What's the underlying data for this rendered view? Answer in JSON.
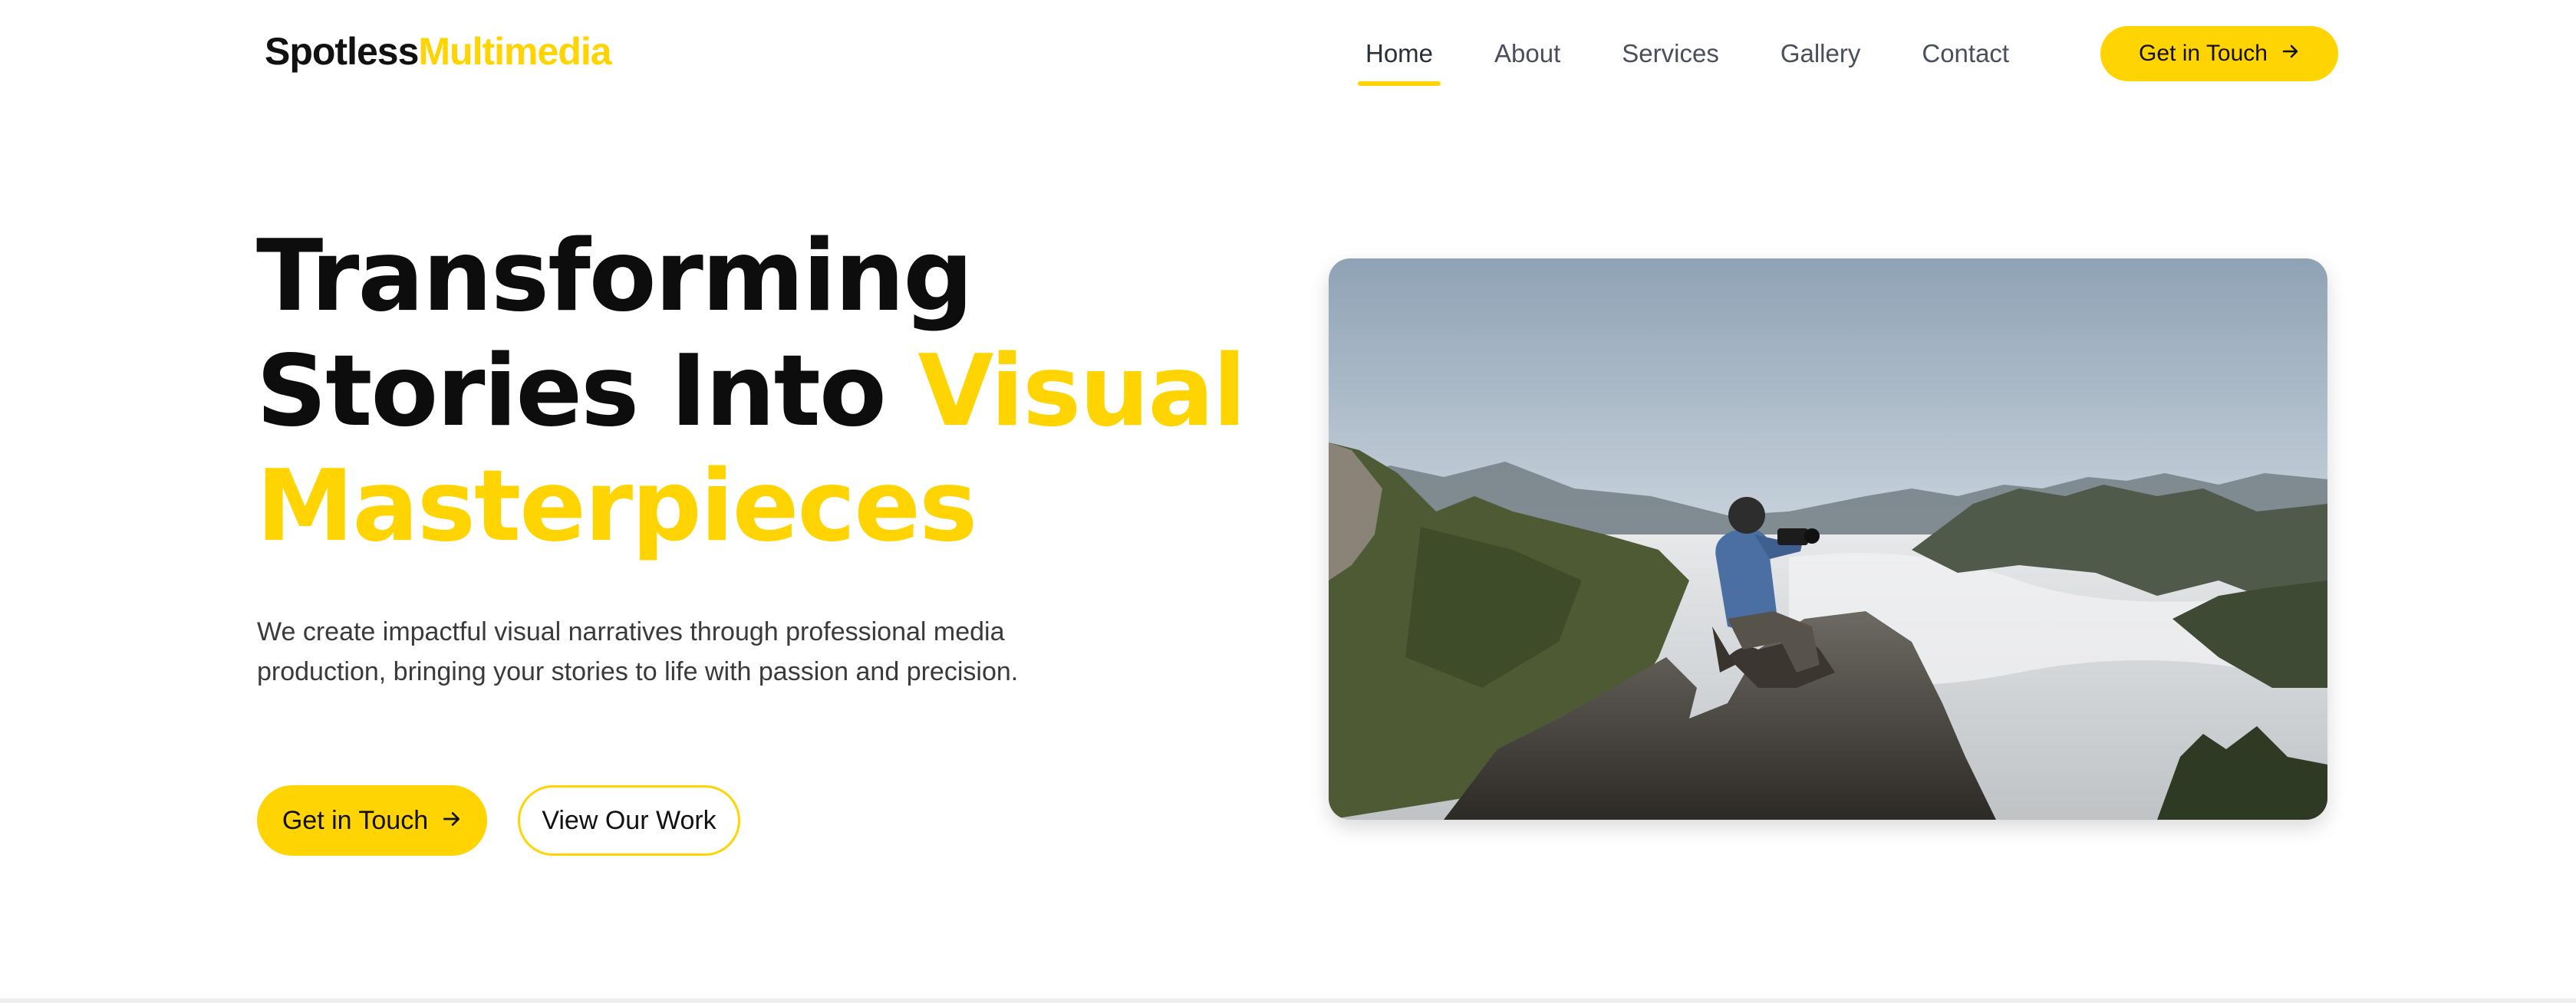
{
  "brand": {
    "name_part1": "Spotless",
    "name_part2": "Multimedia",
    "accent_color": "#FFD400"
  },
  "nav": {
    "items": [
      {
        "label": "Home",
        "active": true
      },
      {
        "label": "About",
        "active": false
      },
      {
        "label": "Services",
        "active": false
      },
      {
        "label": "Gallery",
        "active": false
      },
      {
        "label": "Contact",
        "active": false
      }
    ],
    "cta_label": "Get in Touch",
    "cta_icon": "arrow-right-icon"
  },
  "hero": {
    "title_line1": "Transforming",
    "title_line2_plain": "Stories Into",
    "title_line2_accent": "Visual",
    "title_line3_accent": "Masterpieces",
    "description": "We create impactful visual narratives through professional media production, bringing your stories to life with passion and precision.",
    "primary_button_label": "Get in Touch",
    "secondary_button_label": "View Our Work"
  }
}
